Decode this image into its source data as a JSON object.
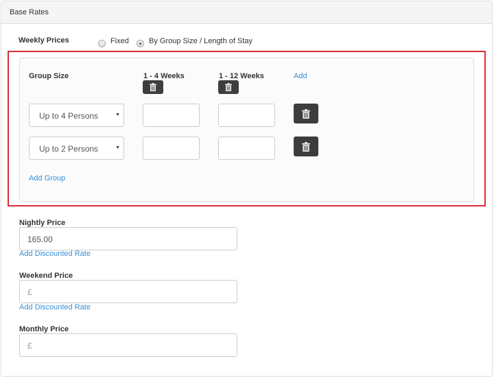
{
  "panel": {
    "title": "Base Rates"
  },
  "weekly": {
    "label": "Weekly Prices",
    "options": [
      {
        "label": "Fixed",
        "checked": false
      },
      {
        "label": "By Group Size / Length of Stay",
        "checked": true
      }
    ]
  },
  "group_table": {
    "group_size_header": "Group Size",
    "columns": [
      {
        "label": "1 - 4 Weeks"
      },
      {
        "label": "1 - 12 Weeks"
      }
    ],
    "add_column_link": "Add",
    "rows": [
      {
        "group": "Up to 4 Persons",
        "values": [
          "",
          ""
        ]
      },
      {
        "group": "Up to 2 Persons",
        "values": [
          "",
          ""
        ]
      }
    ],
    "add_group_link": "Add Group"
  },
  "nightly": {
    "label": "Nightly Price",
    "value": "165.00",
    "discount_link": "Add Discounted Rate"
  },
  "weekend": {
    "label": "Weekend Price",
    "placeholder": "£",
    "discount_link": "Add Discounted Rate"
  },
  "monthly": {
    "label": "Monthly Price",
    "placeholder": "£"
  },
  "colors": {
    "highlight_border": "#dd2b33",
    "link": "#3b8dd1",
    "button_dark": "#3d3d3d"
  }
}
